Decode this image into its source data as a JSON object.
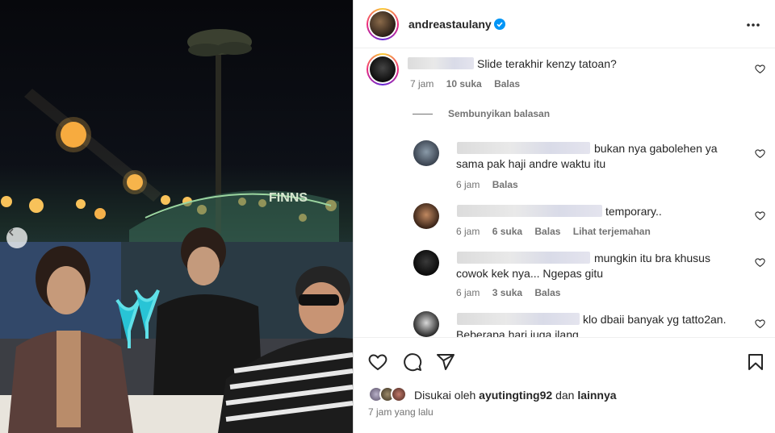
{
  "post": {
    "username": "andreastaulany",
    "verified": true,
    "options_icon": "more-horizontal-icon"
  },
  "photo": {
    "sign_text": "FINNS",
    "prev_icon": "chevron-left-icon"
  },
  "comments": [
    {
      "text": "Slide terakhir kenzy tatoan?",
      "time": "7 jam",
      "likes": "10 suka",
      "reply": "Balas"
    }
  ],
  "hide_replies": "Sembunyikan balasan",
  "replies": [
    {
      "text_line1": "bukan nya gabolehen ya",
      "text_line2": "sama pak haji andre waktu itu",
      "time": "6 jam",
      "reply": "Balas"
    },
    {
      "text_line1": "temporary..",
      "time": "6 jam",
      "likes": "6 suka",
      "reply": "Balas",
      "translate": "Lihat terjemahan"
    },
    {
      "text_line1": "mungkin itu bra khusus",
      "text_line2": "cowok kek nya... Ngepas gitu",
      "time": "6 jam",
      "likes": "3 suka",
      "reply": "Balas"
    },
    {
      "text_line1": "klo dbaii banyak yg tatto2an.",
      "text_line2": "Beberapa hari juga ilang"
    }
  ],
  "actions": {
    "like_icon": "heart-icon",
    "comment_icon": "comment-icon",
    "share_icon": "send-icon",
    "save_icon": "bookmark-icon"
  },
  "likes": {
    "prefix": "Disukai oleh",
    "user": "ayutingting92",
    "connector": "dan",
    "others": "lainnya"
  },
  "posted_time": "7 jam yang lalu",
  "colors": {
    "verified_blue": "#0095f6",
    "text_primary": "#262626",
    "text_secondary": "#737373"
  }
}
